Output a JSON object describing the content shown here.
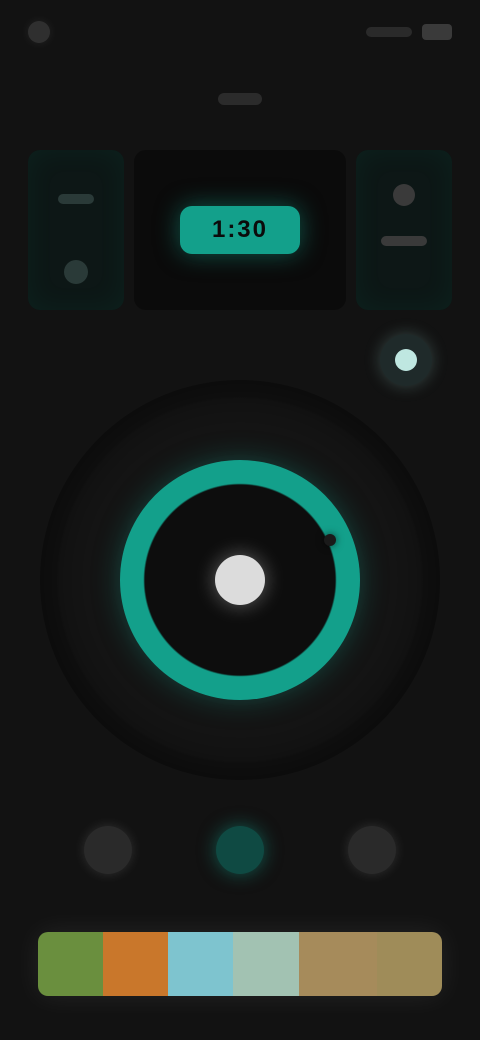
{
  "status": {
    "left_icon": "circle-dot-icon",
    "right_icons": [
      "signal-bars-icon",
      "battery-icon"
    ]
  },
  "header": {
    "title": ""
  },
  "timer": {
    "display": "1:30"
  },
  "controls": {
    "add_icon": "plus-icon",
    "knob_icon": "knob-icon"
  },
  "nav": {
    "items": [
      {
        "name": "left",
        "icon": "circle-icon",
        "active": false
      },
      {
        "name": "center",
        "icon": "circle-icon",
        "active": true
      },
      {
        "name": "right",
        "icon": "circle-icon",
        "active": false
      }
    ]
  },
  "palette": {
    "colors": [
      "#6a8f3e",
      "#c9772b",
      "#7ec4cf",
      "#a2c2b2",
      "#a68b5b",
      "#9f8c59"
    ]
  },
  "accent": "#13a08b"
}
